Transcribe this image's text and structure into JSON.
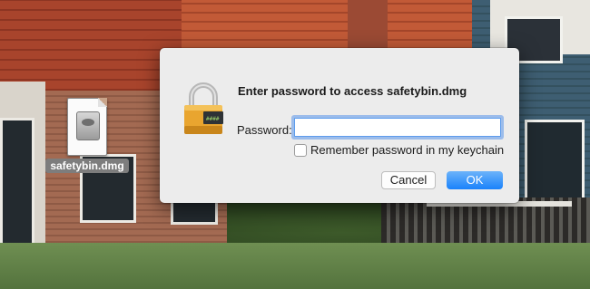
{
  "desktop": {
    "file_icon": {
      "name": "safetybin.dmg",
      "icon": "disk-image-icon"
    }
  },
  "dialog": {
    "icon": "lock-icon",
    "lock_badge": "enabled",
    "title": "Enter password to access safetybin.dmg",
    "password": {
      "label": "Password:",
      "value": ""
    },
    "remember": {
      "label": "Remember password in my keychain",
      "checked": false
    },
    "buttons": {
      "cancel": "Cancel",
      "ok": "OK"
    }
  },
  "colors": {
    "accent": "#1a82fb",
    "dialog_bg": "#ececec",
    "lock_gold": "#e9a52f"
  }
}
